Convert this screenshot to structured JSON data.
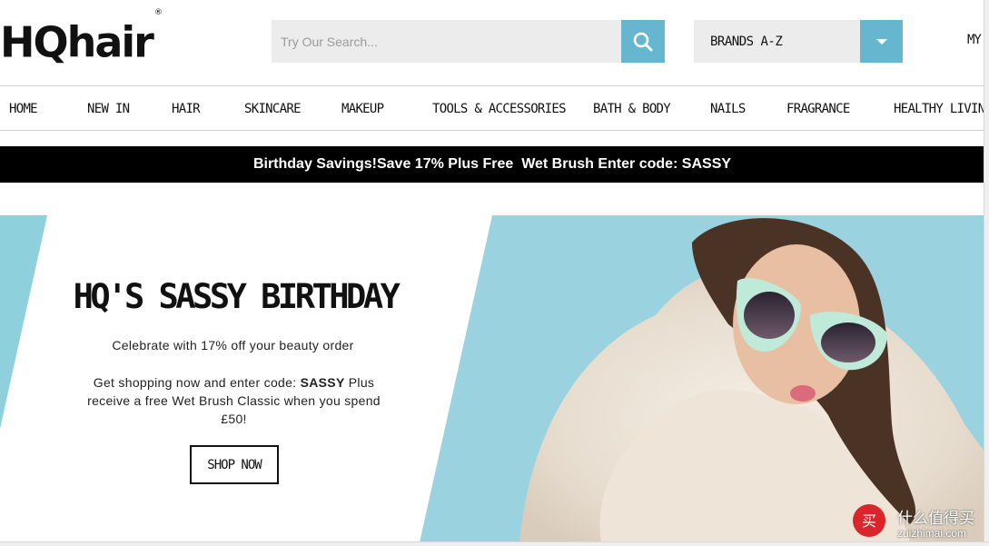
{
  "header": {
    "logo_text": "HQhair",
    "logo_mark": "®",
    "search_placeholder": "Try Our Search...",
    "brands_label": "BRANDS A-Z",
    "account_label": "MY"
  },
  "nav": {
    "items": [
      {
        "label": "HOME"
      },
      {
        "label": "NEW IN"
      },
      {
        "label": "HAIR"
      },
      {
        "label": "SKINCARE"
      },
      {
        "label": "MAKEUP"
      },
      {
        "label": "TOOLS & ACCESSORIES"
      },
      {
        "label": "BATH & BODY"
      },
      {
        "label": "NAILS"
      },
      {
        "label": "FRAGRANCE"
      },
      {
        "label": "HEALTHY LIVING"
      }
    ]
  },
  "promo": {
    "text": "Birthday Savings!Save 17% Plus Free  Wet Brush Enter code: SASSY"
  },
  "hero": {
    "title": "HQ'S SASSY BIRTHDAY",
    "subtitle": "Celebrate with 17% off your beauty order",
    "body_before_code": "Get shopping now and enter code: ",
    "code": "SASSY",
    "body_after_code": " Plus receive a free Wet Brush Classic when you spend £50!",
    "button_label": "SHOP NOW"
  },
  "watermark": {
    "line1": "什么值得买",
    "line2": "zuizhimai.com"
  },
  "colors": {
    "accent": "#67b6cf",
    "hero_bg": "#8fd0dd",
    "promo_bg": "#000000"
  }
}
